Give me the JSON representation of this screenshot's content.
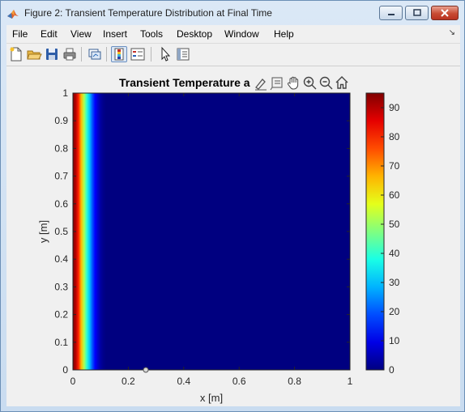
{
  "window": {
    "title": "Figure 2: Transient Temperature Distribution at Final Time",
    "app_icon": "matlab-icon",
    "buttons": [
      "minimize-icon",
      "maximize-icon",
      "close-icon"
    ]
  },
  "menubar": {
    "items": [
      "File",
      "Edit",
      "View",
      "Insert",
      "Tools",
      "Desktop",
      "Window",
      "Help"
    ],
    "overflow_glyph": "↘"
  },
  "toolbar": {
    "icons": [
      "new-figure-icon",
      "open-file-icon",
      "save-icon",
      "print-icon",
      "link-plot-icon",
      "colorbar-icon",
      "legend-icon",
      "pointer-icon",
      "property-inspector-icon"
    ]
  },
  "axes_toolbar": {
    "icons": [
      "brush-icon",
      "data-tip-icon",
      "pan-hand-icon",
      "zoom-in-icon",
      "zoom-out-icon",
      "home-icon"
    ]
  },
  "chart_data": {
    "type": "heatmap",
    "title": "Transient Temperature a",
    "xlabel": "x [m]",
    "ylabel": "y [m]",
    "xlim": [
      0,
      1
    ],
    "ylim": [
      0,
      1
    ],
    "x_ticks": [
      "0",
      "0.2",
      "0.4",
      "0.6",
      "0.8",
      "1"
    ],
    "y_ticks": [
      "0",
      "0.1",
      "0.2",
      "0.3",
      "0.4",
      "0.5",
      "0.6",
      "0.7",
      "0.8",
      "0.9",
      "1"
    ],
    "colormap": "jet",
    "clim": [
      0,
      95
    ],
    "colorbar_ticks": [
      "0",
      "10",
      "20",
      "30",
      "40",
      "50",
      "60",
      "70",
      "80",
      "90"
    ],
    "profile_x": [
      0.0,
      0.01,
      0.02,
      0.03,
      0.04,
      0.05,
      0.06,
      0.07,
      0.08,
      0.09,
      0.1,
      0.11,
      0.12,
      1.0
    ],
    "profile_temperature": [
      95,
      90,
      80,
      66,
      52,
      40,
      30,
      20,
      12,
      7,
      3,
      1,
      0,
      0
    ]
  },
  "colors": {
    "window_frame": "#c9dcf0",
    "figure_bg": "#f0f0f0",
    "close_button": "#c84b33"
  }
}
